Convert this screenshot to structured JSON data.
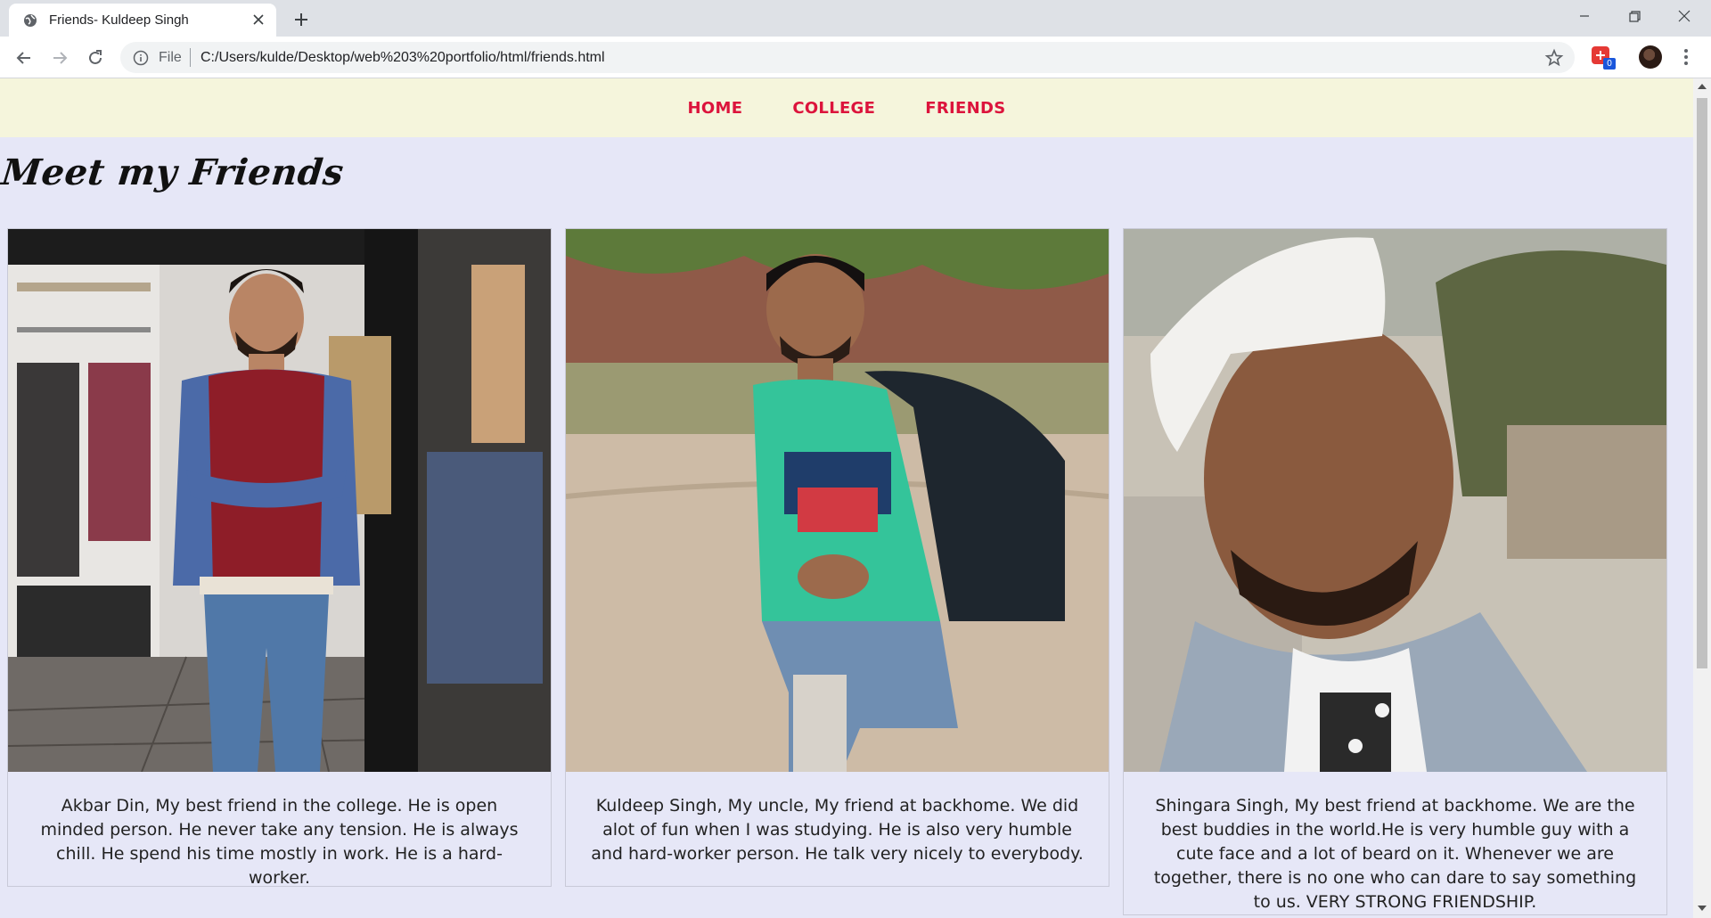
{
  "browser": {
    "tab_title": "Friends- Kuldeep Singh",
    "scheme": "File",
    "url": "C:/Users/kulde/Desktop/web%203%20portfolio/html/friends.html",
    "extension_badge": "0"
  },
  "site": {
    "nav": [
      {
        "label": "HOME"
      },
      {
        "label": "COLLEGE"
      },
      {
        "label": "FRIENDS"
      }
    ],
    "title": "Meet my Friends"
  },
  "friends": [
    {
      "description": "Akbar Din, My best friend in the college. He is open minded person. He never take any tension. He is always chill. He spend his time mostly in work. He is a hard-worker."
    },
    {
      "description": "Kuldeep Singh, My uncle, My friend at backhome. We did alot of fun when I was studying. He is also very humble and hard-worker person. He talk very nicely to everybody."
    },
    {
      "description": "Shingara Singh, My best friend at backhome. We are the best buddies in the world.He is very humble guy with a cute face and a lot of beard on it. Whenever we are together, there is no one who can dare to say something to us. VERY STRONG FRIENDSHIP."
    }
  ],
  "colors": {
    "nav_bg": "#f5f5dc",
    "nav_link": "#dc143c",
    "page_bg": "#e6e7f7"
  }
}
